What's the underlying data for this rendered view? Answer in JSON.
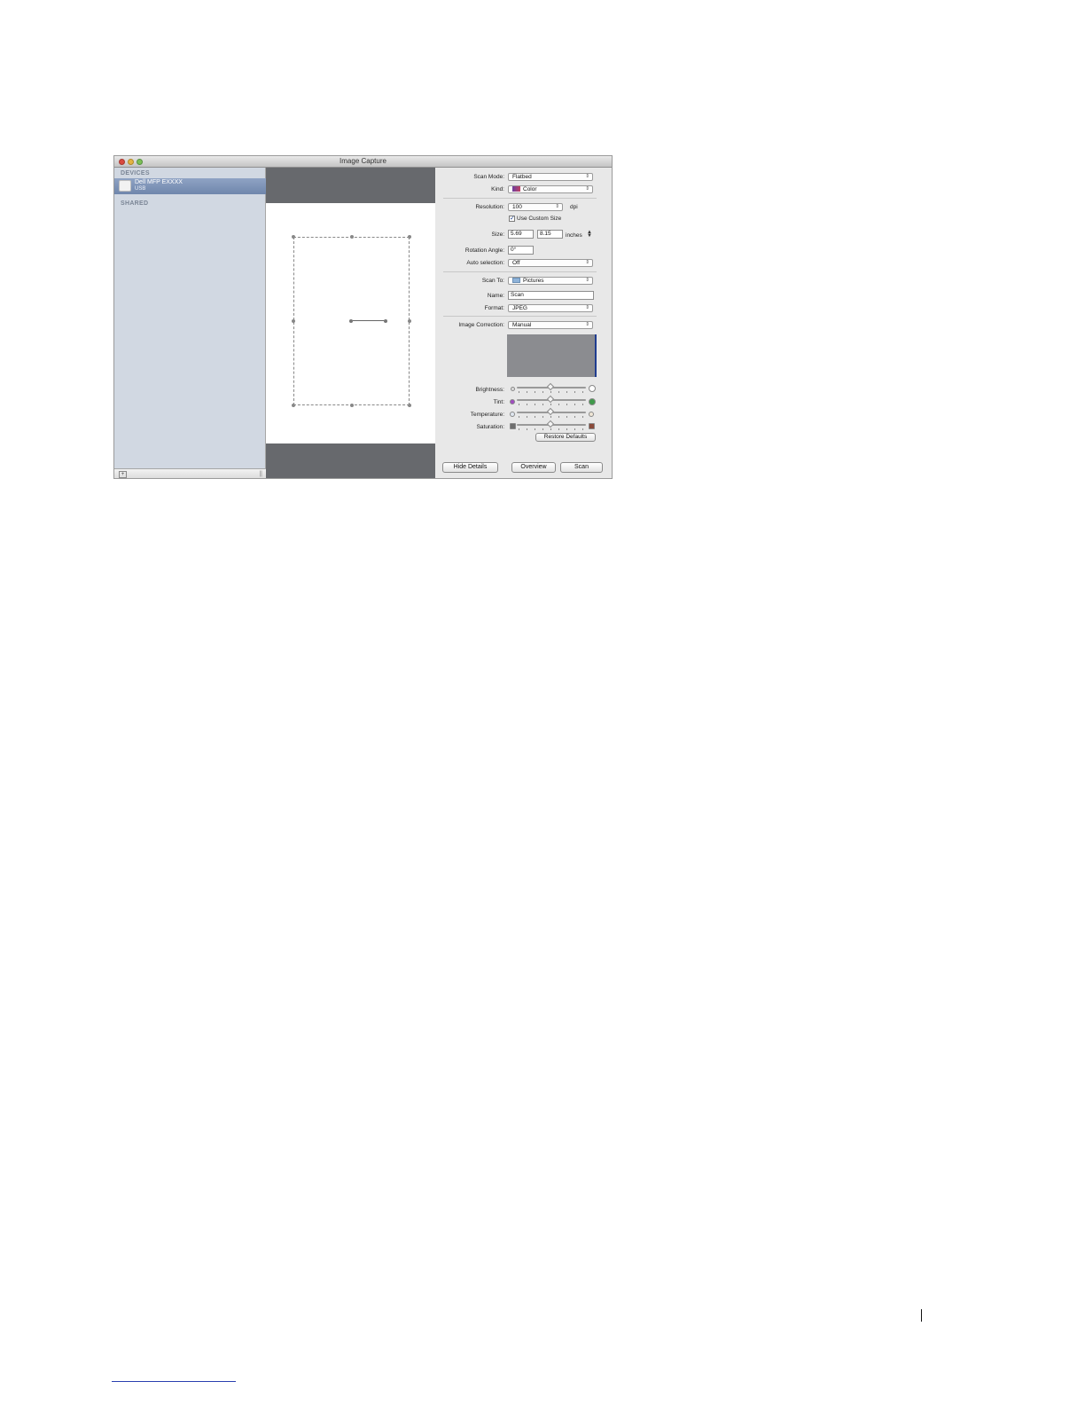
{
  "window": {
    "title": "Image Capture"
  },
  "sidebar": {
    "devices_heading": "DEVICES",
    "device_name": "Dell MFP EXXXX",
    "device_connection": "USB",
    "shared_heading": "SHARED",
    "add_glyph": "+",
    "grip_glyph": "||"
  },
  "details": {
    "scan_mode_label": "Scan Mode:",
    "scan_mode_value": "Flatbed",
    "kind_label": "Kind:",
    "kind_value": "Color",
    "resolution_label": "Resolution:",
    "resolution_value": "100",
    "resolution_unit": "dpi",
    "custom_size_label": "Use Custom Size",
    "custom_size_checked": true,
    "size_label": "Size:",
    "size_width": "5.69",
    "size_height": "8.15",
    "size_unit": "inches",
    "rotation_label": "Rotation Angle:",
    "rotation_value": "0°",
    "auto_selection_label": "Auto selection:",
    "auto_selection_value": "Off",
    "scan_to_label": "Scan To:",
    "scan_to_value": "Pictures",
    "name_label": "Name:",
    "name_value": "Scan",
    "format_label": "Format:",
    "format_value": "JPEG",
    "image_correction_label": "Image Correction:",
    "image_correction_value": "Manual",
    "sliders": {
      "brightness_label": "Brightness:",
      "brightness_level": 0.5,
      "tint_label": "Tint:",
      "tint_level": 0.5,
      "temperature_label": "Temperature:",
      "temperature_level": 0.5,
      "saturation_label": "Saturation:",
      "saturation_level": 0.5
    },
    "restore_defaults_label": "Restore Defaults"
  },
  "buttons": {
    "hide_details": "Hide Details",
    "overview": "Overview",
    "scan": "Scan"
  },
  "colors": {
    "sidebar_bg": "#d1d8e2",
    "selection": "#7a8fb5",
    "preview_bg": "#67696d",
    "tint_left": "#a04cc0",
    "tint_right": "#3f9a4a",
    "histogram_bg": "#8b8c90"
  },
  "icons": {
    "popup_arrow": "⇕",
    "checkmark": "✓"
  }
}
